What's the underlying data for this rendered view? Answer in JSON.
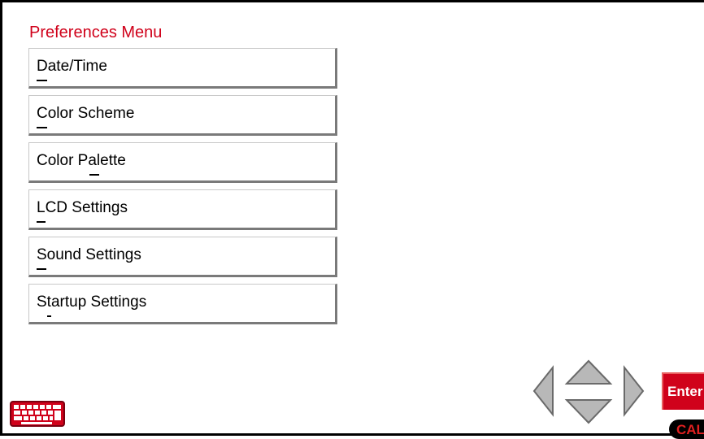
{
  "page": {
    "title": "Preferences Menu"
  },
  "menu": {
    "items": [
      {
        "label": "Date/Time",
        "mnemonic": "D"
      },
      {
        "label": "Color Scheme",
        "mnemonic": "C"
      },
      {
        "label": "Color Palette",
        "mnemonic": "P"
      },
      {
        "label": "LCD Settings",
        "mnemonic": "L"
      },
      {
        "label": "Sound Settings",
        "mnemonic": "S"
      },
      {
        "label": "Startup Settings",
        "mnemonic": "t"
      }
    ]
  },
  "controls": {
    "keyboard_icon": "keyboard-icon",
    "nav_icons": [
      "arrow-left-icon",
      "arrow-up-icon",
      "arrow-down-icon",
      "arrow-right-icon"
    ],
    "enter_label": "Enter",
    "cal_label": "CAL"
  },
  "colors": {
    "accent": "#d0021b",
    "arrow_fill": "#b8b8b8",
    "arrow_stroke": "#6a6a6a"
  }
}
